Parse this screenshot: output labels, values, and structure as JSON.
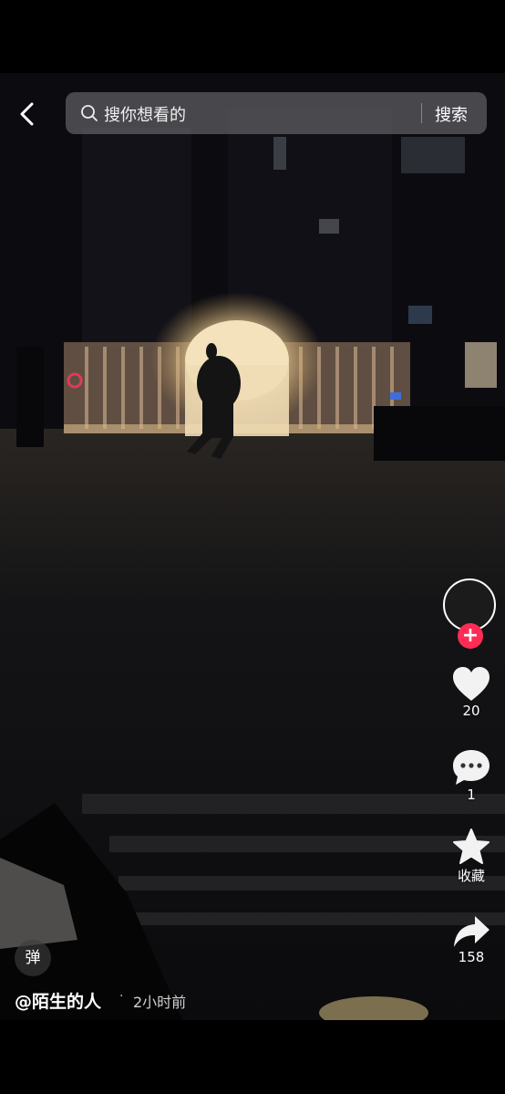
{
  "header": {
    "search_placeholder": "搜你想看的",
    "search_button": "搜索"
  },
  "sidebar": {
    "likes": "20",
    "comments": "1",
    "favorite_label": "收藏",
    "shares": "158"
  },
  "footer": {
    "danmu_label": "弹",
    "author": "@陌生的人",
    "separator": "·",
    "time_ago": "2小时前"
  },
  "colors": {
    "accent": "#fe2c55",
    "search_bg": "#78787d"
  },
  "icons": [
    "back-arrow-icon",
    "search-icon",
    "plus-icon",
    "heart-icon",
    "comment-icon",
    "star-icon",
    "share-icon"
  ]
}
